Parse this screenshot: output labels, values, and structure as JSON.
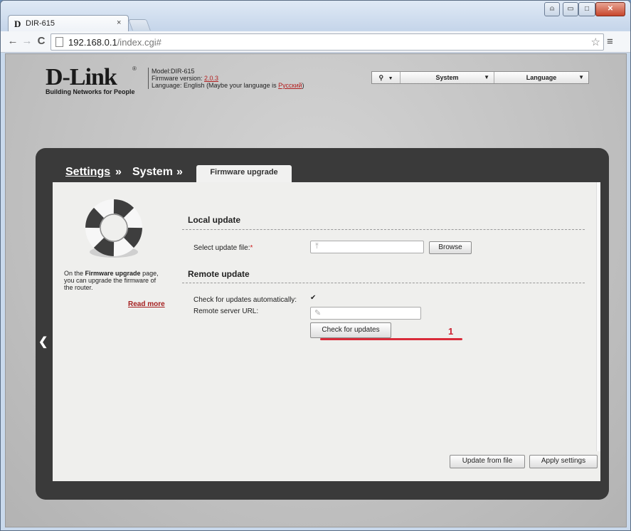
{
  "browser": {
    "tab_title": "DIR-615",
    "tab_favicon": "D",
    "tab_close": "×",
    "url_host": "192.168.0.1",
    "url_path": "/index.cgi#",
    "window_controls": {
      "minimize": "▭",
      "maximize": "□",
      "close": "✕",
      "user": "⍝"
    }
  },
  "header": {
    "logo_text": "D-Link",
    "logo_reg": "®",
    "logo_tagline": "Building Networks for People",
    "model_line": "Model:DIR-615",
    "firmware_prefix": "Firmware version: ",
    "firmware_version": "2.0.3",
    "language_prefix": "Language: English (Maybe your language is ",
    "language_link": "Русский",
    "language_suffix": ")"
  },
  "top_menu": {
    "bulb_arrow": "▼",
    "system_label": "System",
    "language_label": "Language",
    "arrow": "▼"
  },
  "breadcrumb": {
    "settings": "Settings",
    "sep": "»",
    "system": "System",
    "current_tab": "Firmware upgrade"
  },
  "sidebar": {
    "help_prefix": "On the ",
    "help_bold": "Firmware upgrade",
    "help_suffix": " page, you can upgrade the firmware of the router.",
    "read_more": "Read more"
  },
  "local_update": {
    "title": "Local update",
    "select_label": "Select update file:",
    "required_mark": "*",
    "browse_button": "Browse",
    "file_value": ""
  },
  "remote_update": {
    "title": "Remote update",
    "auto_check_label": "Check for updates automatically:",
    "auto_check_checked": true,
    "auto_check_mark": "✔",
    "server_url_label": "Remote server URL:",
    "server_url_value": "",
    "check_button": "Check for updates"
  },
  "annotation": {
    "marker": "1",
    "color": "#d92c3a"
  },
  "footer": {
    "update_from_file": "Update from file",
    "apply_settings": "Apply settings"
  }
}
